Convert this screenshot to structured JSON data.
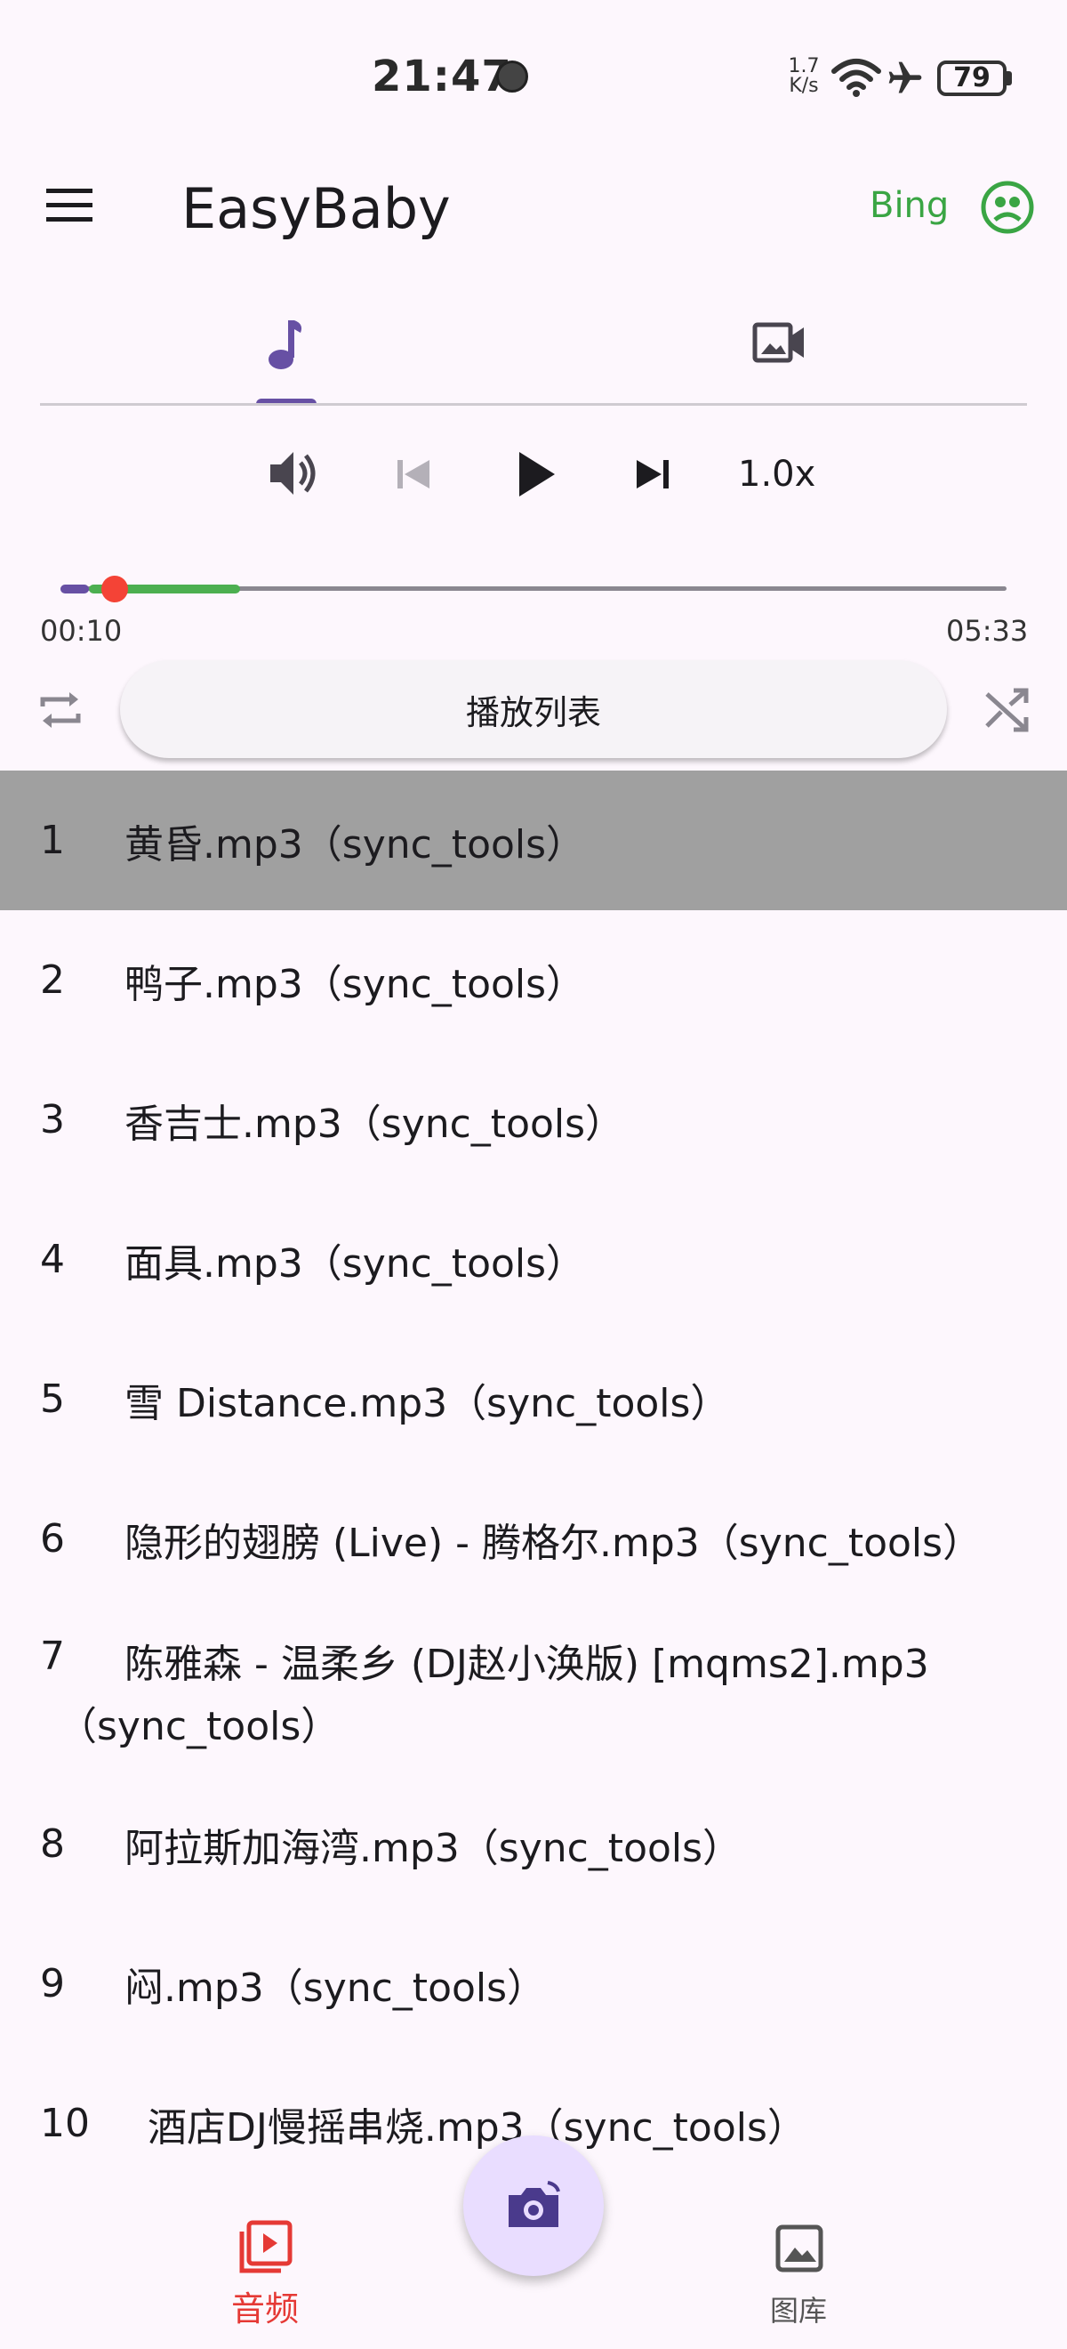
{
  "status_bar": {
    "time": "21:47",
    "net_speed_value": "1.7",
    "net_speed_unit": "K/s",
    "battery": "79"
  },
  "app_bar": {
    "title": "EasyBaby",
    "user_label": "Bing",
    "user_color": "#3aa544"
  },
  "tabs": [
    {
      "icon": "music-note-icon",
      "active": true
    },
    {
      "icon": "video-camera-icon",
      "active": false
    }
  ],
  "player": {
    "speed": "1.0x",
    "current_time": "00:10",
    "total_time": "05:33",
    "progress": 0.03,
    "playlist_button": "播放列表",
    "accent_color": "#6750a4",
    "progress_color": "#4caf50",
    "thumb_color": "#f44336"
  },
  "playlist": [
    {
      "num": "1",
      "name": "黄昏.mp3（sync_tools）",
      "active": true
    },
    {
      "num": "2",
      "name": "鸭子.mp3（sync_tools）"
    },
    {
      "num": "3",
      "name": "香吉士.mp3（sync_tools）"
    },
    {
      "num": "4",
      "name": "面具.mp3（sync_tools）"
    },
    {
      "num": "5",
      "name": "雪 Distance.mp3（sync_tools）"
    },
    {
      "num": "6",
      "name": "隐形的翅膀 (Live) - 腾格尔.mp3（sync_tools）"
    },
    {
      "num": "7",
      "name": "陈雅森 - 温柔乡 (DJ赵小涣版) [mqms2].mp3",
      "name_line2": "（sync_tools）"
    },
    {
      "num": "8",
      "name": "阿拉斯加海湾.mp3（sync_tools）"
    },
    {
      "num": "9",
      "name": "闷.mp3（sync_tools）"
    },
    {
      "num": "10",
      "name": "酒店DJ慢摇串烧.mp3（sync_tools）"
    }
  ],
  "bottom_nav": {
    "audio_label": "音频",
    "gallery_label": "图库",
    "active_color": "#e53935"
  }
}
